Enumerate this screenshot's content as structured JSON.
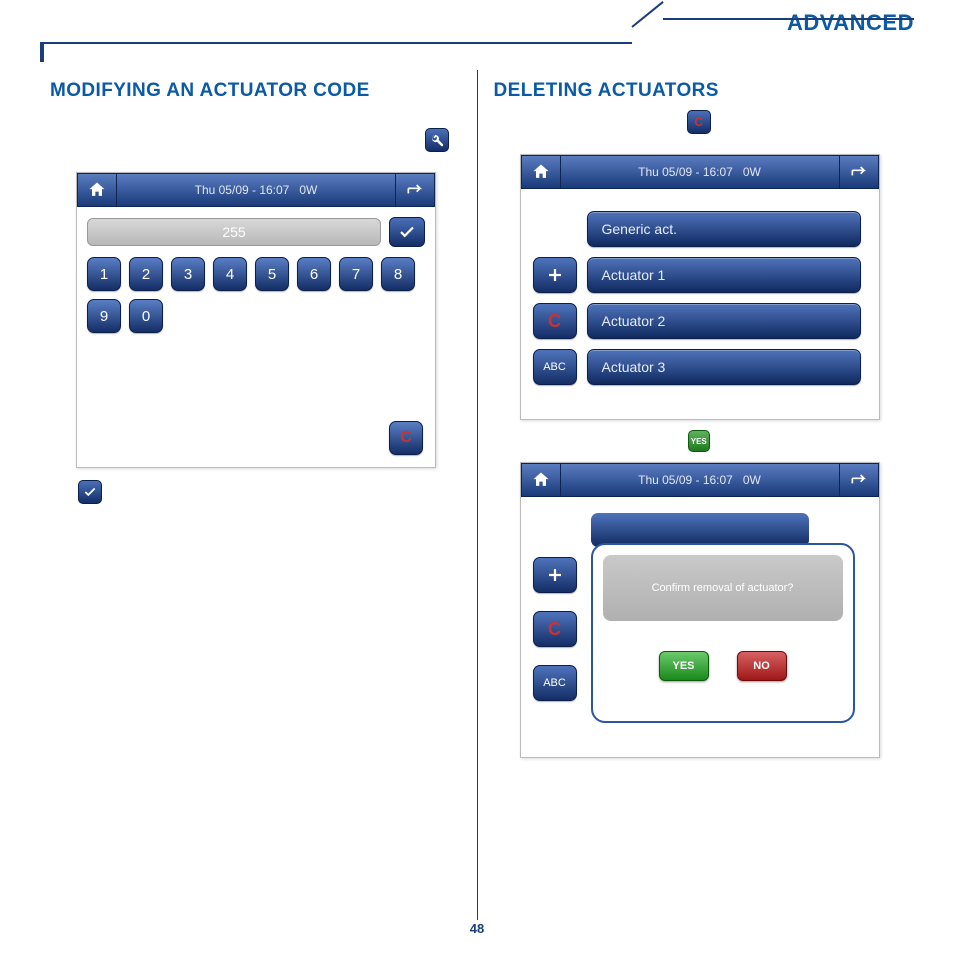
{
  "page": {
    "number": "48",
    "category": "ADVANCED"
  },
  "left": {
    "heading": "MODIFYING AN ACTUATOR CODE",
    "titlebar": {
      "datetime": "Thu 05/09 - 16:07",
      "suffix": "0W"
    },
    "input_value": "255",
    "keys": [
      "1",
      "2",
      "3",
      "4",
      "5",
      "6",
      "7",
      "8",
      "9",
      "0"
    ],
    "clear_label": "C"
  },
  "right": {
    "heading": "DELETING ACTUATORS",
    "screen1": {
      "titlebar": {
        "datetime": "Thu 05/09 - 16:07",
        "suffix": "0W"
      },
      "items": [
        {
          "side": null,
          "label": "Generic act."
        },
        {
          "side": "+",
          "label": "Actuator 1"
        },
        {
          "side": "C",
          "label": "Actuator 2"
        },
        {
          "side": "ABC",
          "label": "Actuator 3"
        }
      ]
    },
    "screen2": {
      "titlebar": {
        "datetime": "Thu 05/09 - 16:07",
        "suffix": "0W"
      },
      "dialog": {
        "message": "Confirm removal of actuator?",
        "yes": "YES",
        "no": "NO"
      },
      "side_keys": [
        "+",
        "C",
        "ABC"
      ]
    },
    "mini_yes": "YES"
  },
  "icons": {
    "wrench": "wrench",
    "check": "check",
    "c_red": "C"
  }
}
